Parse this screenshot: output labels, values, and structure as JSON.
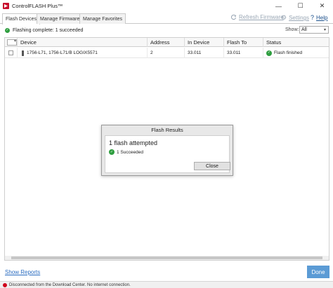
{
  "window": {
    "title": "ControlFLASH Plus™",
    "minimize": "—",
    "maximize": "☐",
    "close": "✕"
  },
  "tabs": [
    {
      "label": "Flash Devices",
      "active": true
    },
    {
      "label": "Manage Firmware",
      "active": false
    },
    {
      "label": "Manage Favorites",
      "active": false
    }
  ],
  "toolbar": {
    "refresh_label": "Refresh Firmware",
    "settings_label": "Settings",
    "help_label": "Help"
  },
  "status": {
    "message": "Flashing complete: 1 succeeded",
    "show_label": "Show:",
    "show_value": "All"
  },
  "table": {
    "columns": [
      "Device",
      "Address",
      "In Device",
      "Flash To",
      "Status"
    ],
    "rows": [
      {
        "device": "1756-L71, 1756-L71/B LOGIX5571",
        "address": "2",
        "in_device": "33.011",
        "flash_to": "33.011",
        "status": "Flash finished"
      }
    ]
  },
  "dialog": {
    "title": "Flash Results",
    "headline": "1 flash attempted",
    "result": "1 Succeeded",
    "close_label": "Close"
  },
  "footer": {
    "show_reports": "Show Reports",
    "done_label": "Done",
    "statusbar_text": "Disconnected from the Download Center. No internet connection."
  },
  "colors": {
    "success": "#2e9e3f",
    "error": "#d0021b",
    "primary_button": "#5b9bd5",
    "link": "#2a6cc0"
  }
}
